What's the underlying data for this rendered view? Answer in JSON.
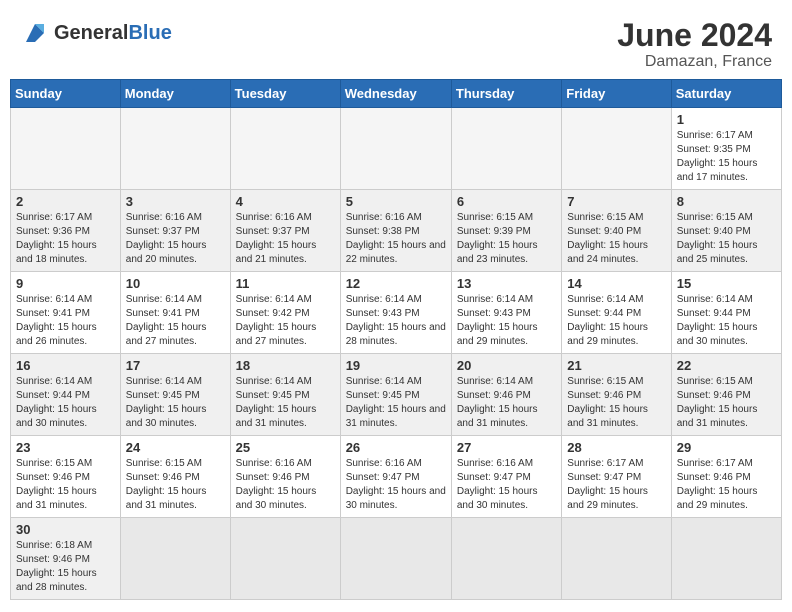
{
  "header": {
    "logo_general": "General",
    "logo_blue": "Blue",
    "title": "June 2024",
    "location": "Damazan, France"
  },
  "days_of_week": [
    "Sunday",
    "Monday",
    "Tuesday",
    "Wednesday",
    "Thursday",
    "Friday",
    "Saturday"
  ],
  "weeks": [
    [
      {
        "day": "",
        "info": ""
      },
      {
        "day": "",
        "info": ""
      },
      {
        "day": "",
        "info": ""
      },
      {
        "day": "",
        "info": ""
      },
      {
        "day": "",
        "info": ""
      },
      {
        "day": "",
        "info": ""
      },
      {
        "day": "1",
        "info": "Sunrise: 6:17 AM\nSunset: 9:35 PM\nDaylight: 15 hours and 17 minutes."
      }
    ],
    [
      {
        "day": "2",
        "info": "Sunrise: 6:17 AM\nSunset: 9:36 PM\nDaylight: 15 hours and 18 minutes."
      },
      {
        "day": "3",
        "info": "Sunrise: 6:16 AM\nSunset: 9:37 PM\nDaylight: 15 hours and 20 minutes."
      },
      {
        "day": "4",
        "info": "Sunrise: 6:16 AM\nSunset: 9:37 PM\nDaylight: 15 hours and 21 minutes."
      },
      {
        "day": "5",
        "info": "Sunrise: 6:16 AM\nSunset: 9:38 PM\nDaylight: 15 hours and 22 minutes."
      },
      {
        "day": "6",
        "info": "Sunrise: 6:15 AM\nSunset: 9:39 PM\nDaylight: 15 hours and 23 minutes."
      },
      {
        "day": "7",
        "info": "Sunrise: 6:15 AM\nSunset: 9:40 PM\nDaylight: 15 hours and 24 minutes."
      },
      {
        "day": "8",
        "info": "Sunrise: 6:15 AM\nSunset: 9:40 PM\nDaylight: 15 hours and 25 minutes."
      }
    ],
    [
      {
        "day": "9",
        "info": "Sunrise: 6:14 AM\nSunset: 9:41 PM\nDaylight: 15 hours and 26 minutes."
      },
      {
        "day": "10",
        "info": "Sunrise: 6:14 AM\nSunset: 9:41 PM\nDaylight: 15 hours and 27 minutes."
      },
      {
        "day": "11",
        "info": "Sunrise: 6:14 AM\nSunset: 9:42 PM\nDaylight: 15 hours and 27 minutes."
      },
      {
        "day": "12",
        "info": "Sunrise: 6:14 AM\nSunset: 9:43 PM\nDaylight: 15 hours and 28 minutes."
      },
      {
        "day": "13",
        "info": "Sunrise: 6:14 AM\nSunset: 9:43 PM\nDaylight: 15 hours and 29 minutes."
      },
      {
        "day": "14",
        "info": "Sunrise: 6:14 AM\nSunset: 9:44 PM\nDaylight: 15 hours and 29 minutes."
      },
      {
        "day": "15",
        "info": "Sunrise: 6:14 AM\nSunset: 9:44 PM\nDaylight: 15 hours and 30 minutes."
      }
    ],
    [
      {
        "day": "16",
        "info": "Sunrise: 6:14 AM\nSunset: 9:44 PM\nDaylight: 15 hours and 30 minutes."
      },
      {
        "day": "17",
        "info": "Sunrise: 6:14 AM\nSunset: 9:45 PM\nDaylight: 15 hours and 30 minutes."
      },
      {
        "day": "18",
        "info": "Sunrise: 6:14 AM\nSunset: 9:45 PM\nDaylight: 15 hours and 31 minutes."
      },
      {
        "day": "19",
        "info": "Sunrise: 6:14 AM\nSunset: 9:45 PM\nDaylight: 15 hours and 31 minutes."
      },
      {
        "day": "20",
        "info": "Sunrise: 6:14 AM\nSunset: 9:46 PM\nDaylight: 15 hours and 31 minutes."
      },
      {
        "day": "21",
        "info": "Sunrise: 6:15 AM\nSunset: 9:46 PM\nDaylight: 15 hours and 31 minutes."
      },
      {
        "day": "22",
        "info": "Sunrise: 6:15 AM\nSunset: 9:46 PM\nDaylight: 15 hours and 31 minutes."
      }
    ],
    [
      {
        "day": "23",
        "info": "Sunrise: 6:15 AM\nSunset: 9:46 PM\nDaylight: 15 hours and 31 minutes."
      },
      {
        "day": "24",
        "info": "Sunrise: 6:15 AM\nSunset: 9:46 PM\nDaylight: 15 hours and 31 minutes."
      },
      {
        "day": "25",
        "info": "Sunrise: 6:16 AM\nSunset: 9:46 PM\nDaylight: 15 hours and 30 minutes."
      },
      {
        "day": "26",
        "info": "Sunrise: 6:16 AM\nSunset: 9:47 PM\nDaylight: 15 hours and 30 minutes."
      },
      {
        "day": "27",
        "info": "Sunrise: 6:16 AM\nSunset: 9:47 PM\nDaylight: 15 hours and 30 minutes."
      },
      {
        "day": "28",
        "info": "Sunrise: 6:17 AM\nSunset: 9:47 PM\nDaylight: 15 hours and 29 minutes."
      },
      {
        "day": "29",
        "info": "Sunrise: 6:17 AM\nSunset: 9:46 PM\nDaylight: 15 hours and 29 minutes."
      }
    ],
    [
      {
        "day": "30",
        "info": "Sunrise: 6:18 AM\nSunset: 9:46 PM\nDaylight: 15 hours and 28 minutes."
      },
      {
        "day": "",
        "info": ""
      },
      {
        "day": "",
        "info": ""
      },
      {
        "day": "",
        "info": ""
      },
      {
        "day": "",
        "info": ""
      },
      {
        "day": "",
        "info": ""
      },
      {
        "day": "",
        "info": ""
      }
    ]
  ]
}
